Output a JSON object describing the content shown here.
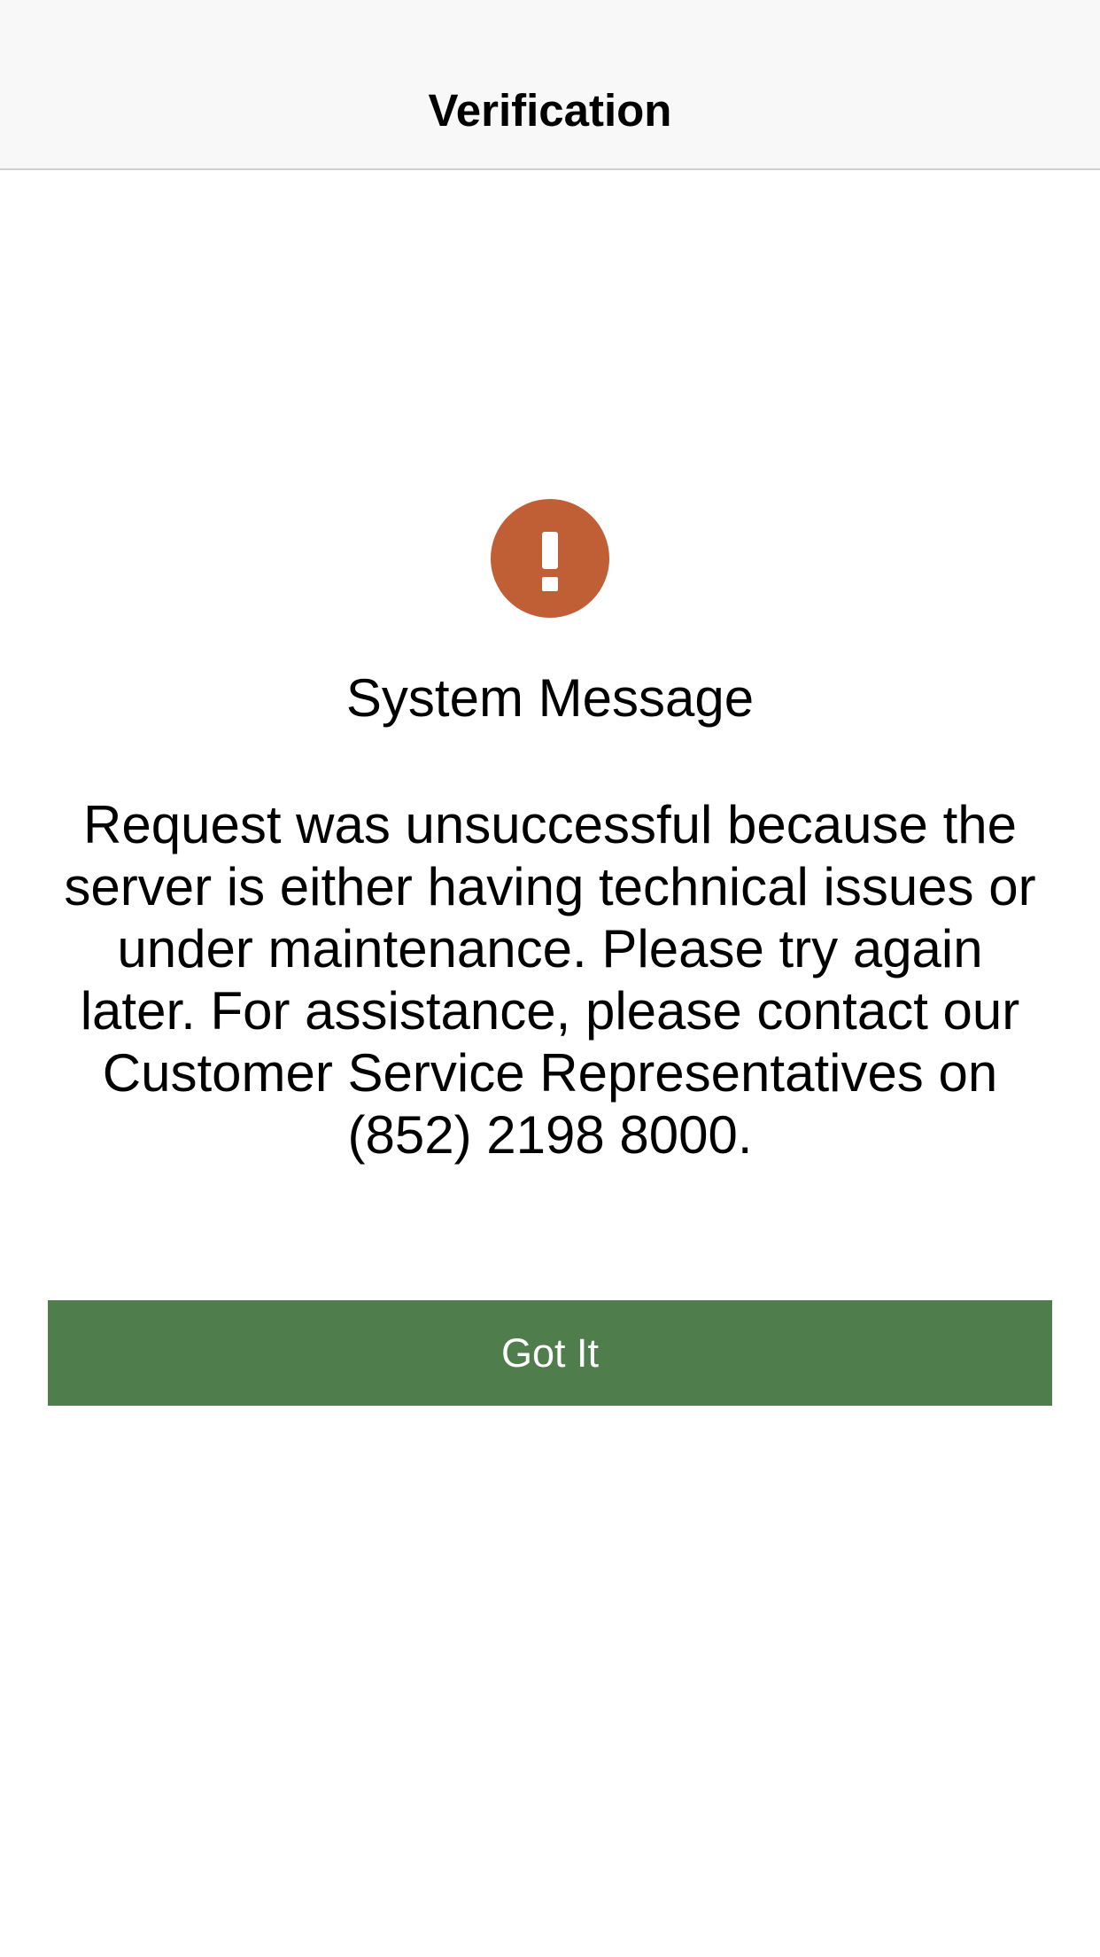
{
  "nav": {
    "title": "Verification"
  },
  "alert": {
    "icon": "exclamation-circle-icon",
    "icon_color": "#c05f35",
    "title": "System Message",
    "body": "Request was unsuccessful because the server is either having technical issues or under maintenance. Please try again later. For assistance, please contact our Customer Service Representatives on (852) 2198 8000."
  },
  "actions": {
    "got_it_label": "Got It",
    "button_color": "#4f7d4b"
  }
}
